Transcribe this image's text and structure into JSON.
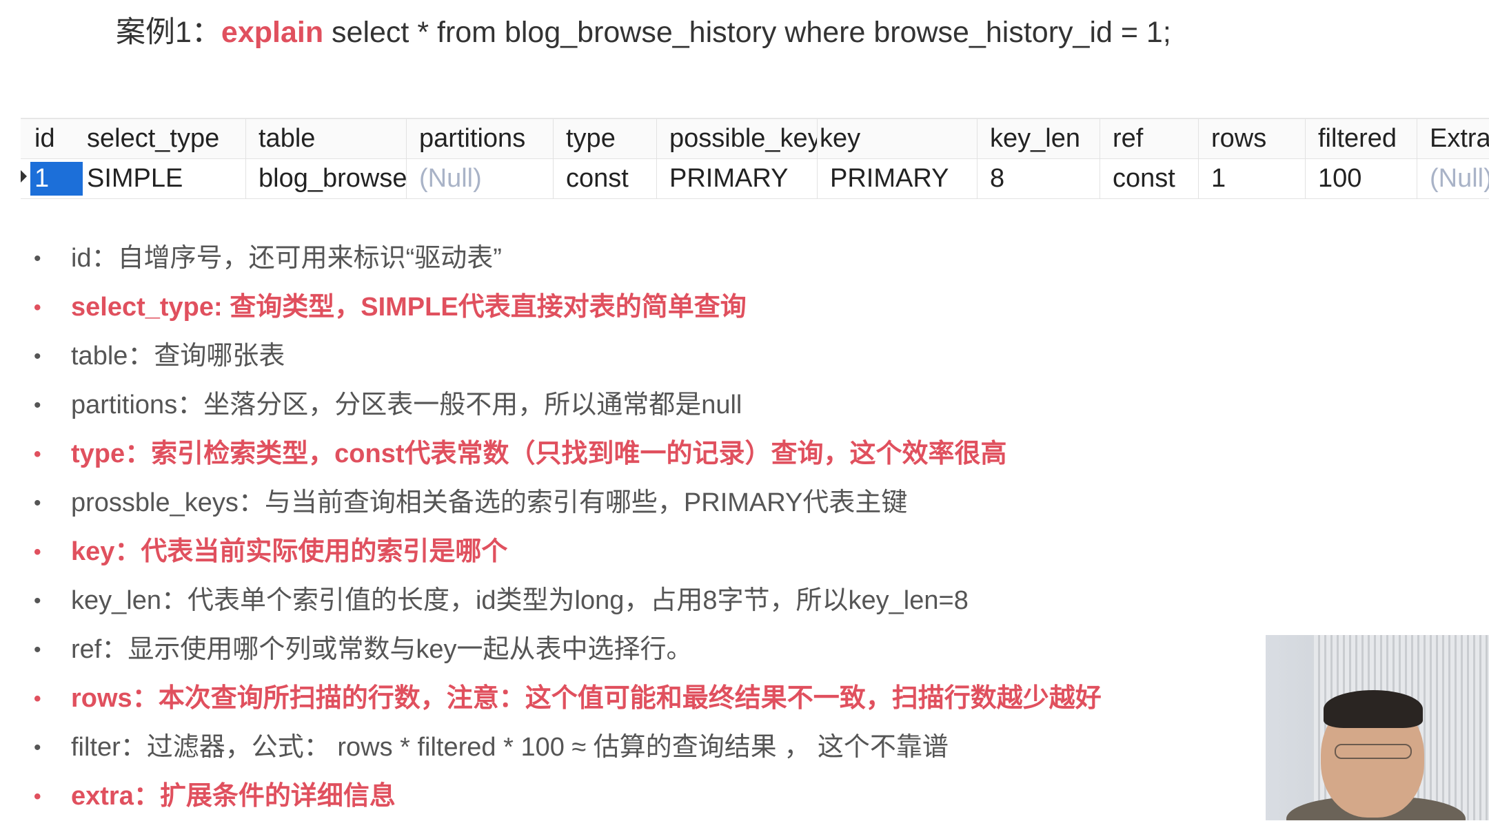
{
  "title": {
    "prefix": "案例1：",
    "keyword": "explain",
    "query": " select * from blog_browse_history where browse_history_id = 1;"
  },
  "table": {
    "headers": [
      "id",
      "select_type",
      "table",
      "partitions",
      "type",
      "possible_keys",
      "key",
      "key_len",
      "ref",
      "rows",
      "filtered",
      "Extra"
    ],
    "row": [
      "1",
      "SIMPLE",
      "blog_browse_history",
      "(Null)",
      "const",
      "PRIMARY",
      "PRIMARY",
      "8",
      "const",
      "1",
      "100",
      "(Null)"
    ]
  },
  "bullets": [
    {
      "text": "id：自增序号，还可用来标识“驱动表”",
      "highlight": false
    },
    {
      "text": "select_type: 查询类型，SIMPLE代表直接对表的简单查询",
      "highlight": true
    },
    {
      "text": "table：查询哪张表",
      "highlight": false
    },
    {
      "text": "partitions：坐落分区，分区表一般不用，所以通常都是null",
      "highlight": false
    },
    {
      "text": "type：索引检索类型，const代表常数（只找到唯一的记录）查询，这个效率很高",
      "highlight": true
    },
    {
      "text": "prossble_keys：与当前查询相关备选的索引有哪些，PRIMARY代表主键",
      "highlight": false
    },
    {
      "text": "key：代表当前实际使用的索引是哪个",
      "highlight": true
    },
    {
      "text": "key_len：代表单个索引值的长度，id类型为long，占用8字节，所以key_len=8",
      "highlight": false
    },
    {
      "text": "ref：显示使用哪个列或常数与key一起从表中选择行。",
      "highlight": false
    },
    {
      "text": "rows：本次查询所扫描的行数，注意：这个值可能和最终结果不一致，扫描行数越少越好",
      "highlight": true
    },
    {
      "text": "filter：过滤器，公式： rows * filtered * 100 ≈ 估算的查询结果 ， 这个不靠谱",
      "highlight": false
    },
    {
      "text": "extra：扩展条件的详细信息",
      "highlight": true
    }
  ],
  "bullet_symbol": "•",
  "colors": {
    "highlight": "#e0505e",
    "selection": "#1c6fd9",
    "null_text": "#a9b3c7"
  }
}
